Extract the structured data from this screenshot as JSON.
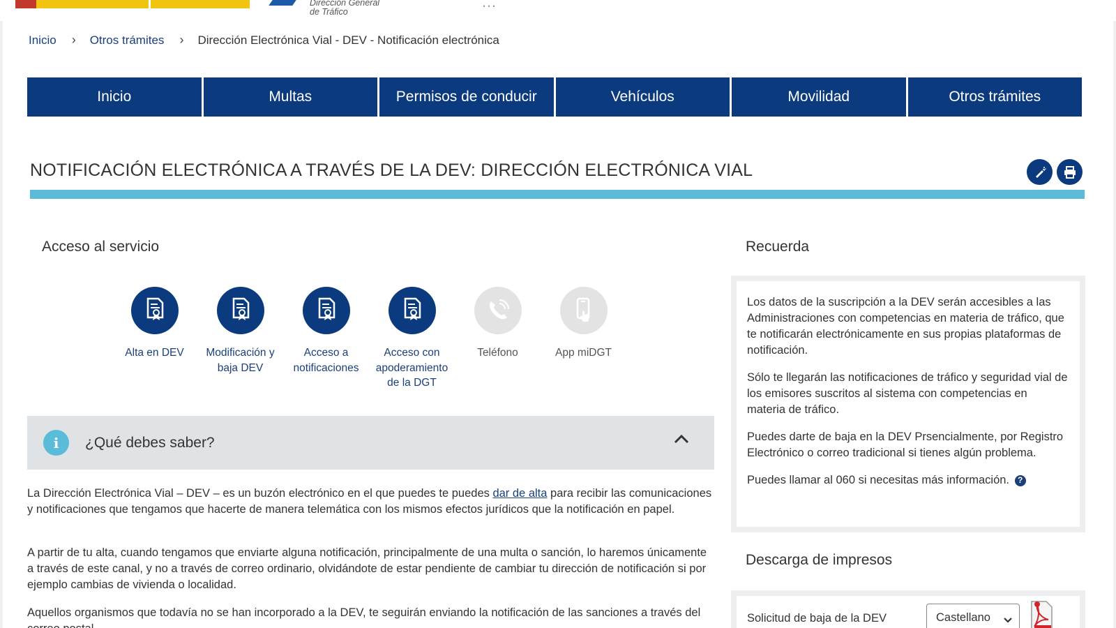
{
  "header": {
    "agency_line1": "Dirección General",
    "agency_line2": "de Tráfico",
    "site_fragment": "…"
  },
  "breadcrumb": {
    "items": [
      "Inicio",
      "Otros trámites"
    ],
    "separator": "›",
    "current": "Dirección Electrónica Vial - DEV - Notificación electrónica"
  },
  "nav": {
    "items": [
      "Inicio",
      "Multas",
      "Permisos de conducir",
      "Vehículos",
      "Movilidad",
      "Otros trámites"
    ]
  },
  "page": {
    "title": "NOTIFICACIÓN ELECTRÓNICA A TRAVÉS DE LA DEV: DIRECCIÓN ELECTRÓNICA VIAL",
    "title_icons": [
      "edit-icon",
      "print-icon"
    ]
  },
  "access": {
    "heading": "Acceso al servicio",
    "services": [
      {
        "line1": "Alta en DEV",
        "line2": "",
        "line3": "",
        "icon": "document-icon",
        "enabled": true
      },
      {
        "line1": "Modificación y",
        "line2": "baja DEV",
        "line3": "",
        "icon": "document-icon",
        "enabled": true
      },
      {
        "line1": "Acceso a",
        "line2": "notificaciones",
        "line3": "",
        "icon": "document-icon",
        "enabled": true
      },
      {
        "line1": "Acceso con",
        "line2": "apoderamiento",
        "line3": "de la DGT",
        "icon": "document-icon",
        "enabled": true
      },
      {
        "line1": "Teléfono",
        "line2": "",
        "line3": "",
        "icon": "phone-icon",
        "enabled": false
      },
      {
        "line1": "App miDGT",
        "line2": "",
        "line3": "",
        "icon": "mobile-app-icon",
        "enabled": false
      }
    ]
  },
  "accordion": {
    "info_glyph": "i",
    "title": "¿Qué debes saber?"
  },
  "content": {
    "p1_before": "La Dirección Electrónica Vial – DEV – es un buzón electrónico en el que puedes te puedes ",
    "p1_link": "dar de alta",
    "p1_after": " para recibir las comunicaciones y notificaciones que tengamos que hacerte de manera telemática con los mismos efectos jurídicos que la notificación en papel.",
    "p2": "A partir de tu alta, cuando tengamos que enviarte alguna notificación, principalmente de una multa o sanción, lo haremos únicamente a través de este canal, y no a través de correo ordinario, olvidándote de estar pendiente de cambiar tu dirección de notificación si por ejemplo cambias de vivienda o localidad.",
    "p3": "Aquellos organismos que todavía no se han incorporado a la DEV, te seguirán enviando la notificación de las sanciones a través del correo postal."
  },
  "recuerda": {
    "heading": "Recuerda",
    "paragraphs": [
      "Los datos de la suscripción a la DEV serán accesibles a las Administraciones con competencias en materia de tráfico, que te notificarán electrónicamente en sus propias plataformas de notificación.",
      "Sólo te llegarán las notificaciones de tráfico y seguridad vial de los emisores suscritos al sistema con competencias en materia de tráfico.",
      "Puedes darte de baja en la DEV Prsencialmente, por Registro Electrónico o correo tradicional si tienes algún problema."
    ],
    "phone_line": "Puedes llamar al 060 si necesitas más información.",
    "help_glyph": "?"
  },
  "descarga": {
    "heading": "Descarga de impresos",
    "form_label": "Solicitud de baja de la DEV",
    "language_selected": "Castellano",
    "file_icon": "pdf-icon"
  },
  "colors": {
    "nav_blue": "#0b3a7e",
    "accent_cyan": "#5bbcd9",
    "link_blue": "#1a3f7a",
    "panel_grey": "#dfe3e6"
  }
}
